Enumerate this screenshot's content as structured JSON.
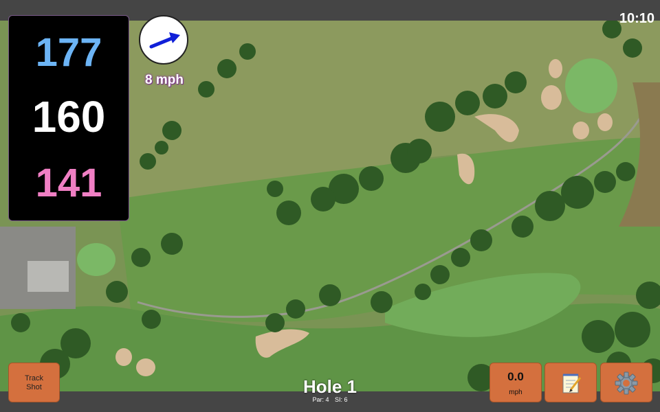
{
  "status": {
    "clock": "10:10"
  },
  "distances": {
    "back": "177",
    "middle": "160",
    "front": "141",
    "colors": {
      "back": "#6cb4f5",
      "middle": "#ffffff",
      "front": "#f07fc4"
    }
  },
  "wind": {
    "speed": "8 mph",
    "arrow_color": "#1020d8"
  },
  "buttons": {
    "track_shot_label": "Track\nShot",
    "speed_value": "0.0",
    "speed_unit": "mph",
    "notes_icon": "notepad-icon",
    "settings_icon": "gear-icon",
    "accent": "#d4703e"
  },
  "hole": {
    "title": "Hole 1",
    "par": "Par: 4",
    "si": "SI: 6"
  },
  "map": {
    "colors": {
      "fairway": "#6a9a4a",
      "rough": "#7e9658",
      "bunker": "#d8bc9a",
      "trees": "#2f5a25",
      "green": "#7bb866"
    }
  }
}
